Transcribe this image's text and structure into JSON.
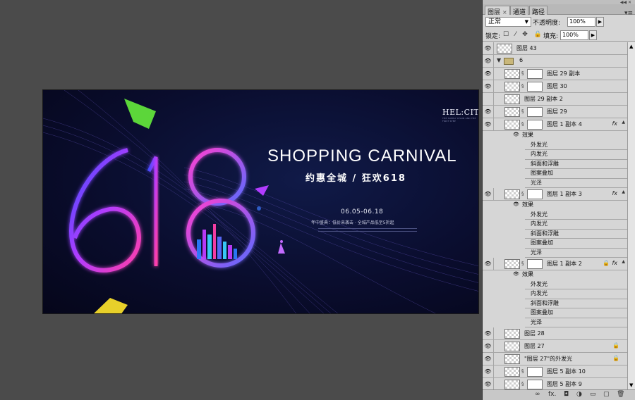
{
  "poster": {
    "brand": "HEL:CITY",
    "brand_sub": "THE SUPPLY CHAIN AND THE FIRST STEP",
    "title": "SHOPPING CARNIVAL",
    "subtitle": "约惠全城 / 狂欢618",
    "date": "06.05-06.18",
    "promo": "年中盛典：低价来袭击 · 全城产品低至5折起",
    "big_number": "618"
  },
  "panel": {
    "tabs": [
      {
        "label": "图层",
        "active": true
      },
      {
        "label": "通道",
        "active": false
      },
      {
        "label": "路径",
        "active": false
      }
    ],
    "blend_mode": "正常",
    "opacity_label": "不透明度:",
    "opacity_value": "100%",
    "lock_label": "锁定:",
    "fill_label": "填充:",
    "fill_value": "100%"
  },
  "layers": [
    {
      "name": "图层 43",
      "visible": true,
      "indent": 0,
      "type": "layer"
    },
    {
      "name": "6",
      "visible": true,
      "indent": 0,
      "type": "group"
    },
    {
      "name": "图层 29 副本",
      "visible": true,
      "indent": 1,
      "type": "masked"
    },
    {
      "name": "图层 30",
      "visible": true,
      "indent": 1,
      "type": "masked"
    },
    {
      "name": "图层 29 副本 2",
      "visible": false,
      "indent": 1,
      "type": "layer"
    },
    {
      "name": "图层 29",
      "visible": true,
      "indent": 1,
      "type": "masked"
    },
    {
      "name": "图层 1 副本 4",
      "visible": true,
      "indent": 1,
      "type": "masked",
      "fx": true
    },
    {
      "name": "效果",
      "type": "effect-head"
    },
    {
      "name": "外发光",
      "type": "effect"
    },
    {
      "name": "内发光",
      "type": "effect"
    },
    {
      "name": "斜面和浮雕",
      "type": "effect"
    },
    {
      "name": "图案叠加",
      "type": "effect"
    },
    {
      "name": "光泽",
      "type": "effect"
    },
    {
      "name": "图层 1 副本 3",
      "visible": true,
      "indent": 1,
      "type": "masked",
      "fx": true
    },
    {
      "name": "效果",
      "type": "effect-head"
    },
    {
      "name": "外发光",
      "type": "effect"
    },
    {
      "name": "内发光",
      "type": "effect"
    },
    {
      "name": "斜面和浮雕",
      "type": "effect"
    },
    {
      "name": "图案叠加",
      "type": "effect"
    },
    {
      "name": "光泽",
      "type": "effect"
    },
    {
      "name": "图层 1 副本 2",
      "visible": true,
      "indent": 1,
      "type": "masked",
      "fx": true,
      "lock": true
    },
    {
      "name": "效果",
      "type": "effect-head"
    },
    {
      "name": "外发光",
      "type": "effect"
    },
    {
      "name": "内发光",
      "type": "effect"
    },
    {
      "name": "斜面和浮雕",
      "type": "effect"
    },
    {
      "name": "图案叠加",
      "type": "effect"
    },
    {
      "name": "光泽",
      "type": "effect"
    },
    {
      "name": "图层 28",
      "visible": true,
      "indent": 1,
      "type": "layer"
    },
    {
      "name": "图层 27",
      "visible": true,
      "indent": 1,
      "type": "layer",
      "lock2": true
    },
    {
      "name": "\"图层 27\"的外发光",
      "visible": true,
      "indent": 1,
      "type": "layer",
      "lock2": true
    },
    {
      "name": "图层 5 副本 10",
      "visible": true,
      "indent": 1,
      "type": "masked"
    },
    {
      "name": "图层 5 副本 9",
      "visible": true,
      "indent": 1,
      "type": "masked"
    }
  ],
  "icons": {
    "eye": "eye-icon",
    "link": "chain-link-icon",
    "fx": "fx-icon",
    "lock": "lock-icon",
    "folder": "folder-icon"
  }
}
